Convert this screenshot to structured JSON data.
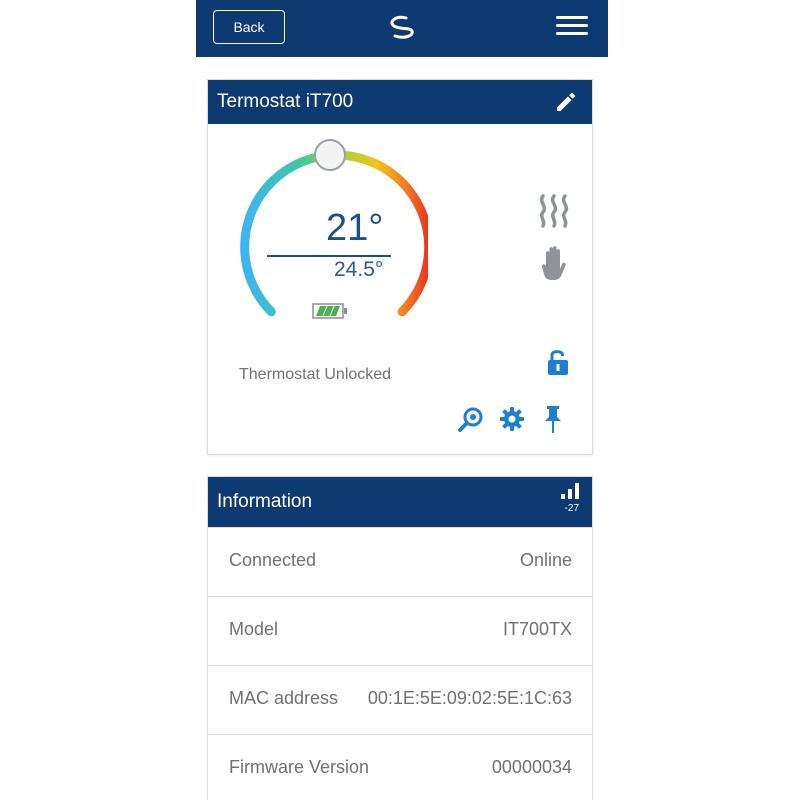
{
  "header": {
    "back_label": "Back",
    "logo_icon": "salus-logo-icon",
    "menu_icon": "hamburger-menu-icon"
  },
  "thermostat": {
    "title": "Termostat iT700",
    "setpoint": "21°",
    "current": "24.5°",
    "status": "Thermostat Unlocked",
    "icons": [
      "edit-icon",
      "heating-icon",
      "manual-mode-icon",
      "battery-icon",
      "unlock-icon",
      "search-icon",
      "gear-icon",
      "pin-icon"
    ]
  },
  "information": {
    "title": "Information",
    "signal": "-27",
    "rows": [
      {
        "label": "Connected",
        "value": "Online"
      },
      {
        "label": "Model",
        "value": "IT700TX"
      },
      {
        "label": "MAC address",
        "value": "00:1E:5E:09:02:5E:1C:63"
      },
      {
        "label": "Firmware Version",
        "value": "00000034"
      }
    ]
  },
  "colors": {
    "primary": "#0e3a72",
    "accent": "#1e7fd1",
    "battery": "#4caf50"
  }
}
